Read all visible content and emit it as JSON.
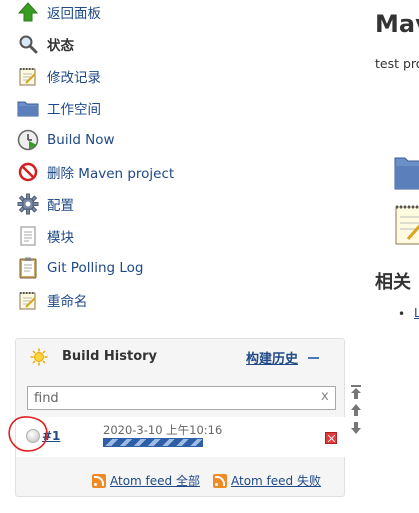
{
  "sidebar": {
    "items": [
      {
        "label": "返回面板",
        "icon": "up-arrow-icon"
      },
      {
        "label": "状态",
        "icon": "magnifier-icon",
        "bold": true
      },
      {
        "label": "修改记录",
        "icon": "notepad-icon"
      },
      {
        "label": "工作空间",
        "icon": "folder-icon"
      },
      {
        "label": "Build Now",
        "icon": "clock-play-icon"
      },
      {
        "label": "删除 Maven project",
        "icon": "no-entry-icon"
      },
      {
        "label": "配置",
        "icon": "gear-icon"
      },
      {
        "label": "模块",
        "icon": "document-icon"
      },
      {
        "label": "Git Polling Log",
        "icon": "clipboard-icon"
      },
      {
        "label": "重命名",
        "icon": "notepad-icon"
      }
    ]
  },
  "main": {
    "title": "Mav",
    "description": "test pro",
    "related_heading": "相关",
    "related_link": "L"
  },
  "build_history": {
    "title": "Build History",
    "trend_label": "构建历史",
    "search_value": "find",
    "clear_label": "x",
    "builds": [
      {
        "number": "#1",
        "date": "2020-3-10 上午10:16",
        "progress": 1.0
      }
    ],
    "feed_all": "Atom feed 全部",
    "feed_failures": "Atom feed 失败"
  },
  "colors": {
    "link": "#204a87",
    "progress": "#2e5fa6",
    "annotation": "#e02020"
  }
}
